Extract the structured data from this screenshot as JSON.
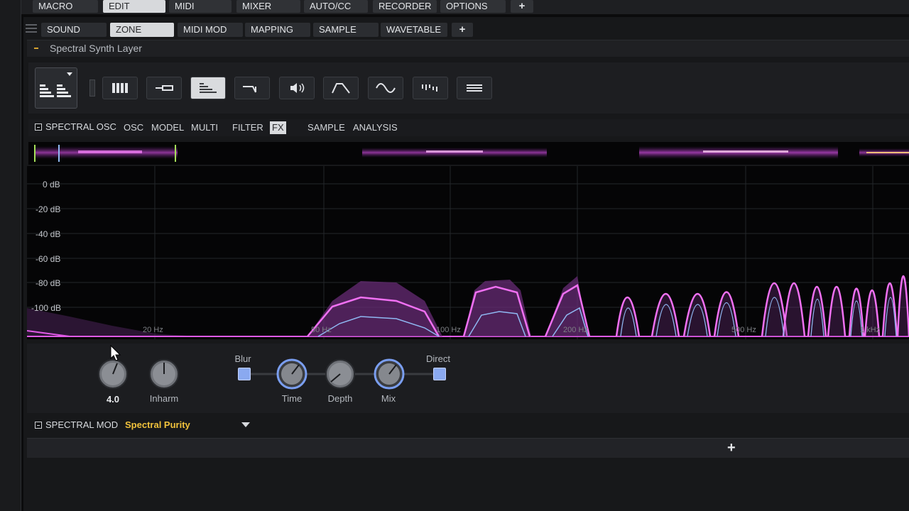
{
  "top_tabs": [
    {
      "label": "MACRO"
    },
    {
      "label": "EDIT",
      "active": true
    },
    {
      "label": "MIDI"
    },
    {
      "label": "MIXER"
    },
    {
      "label": "AUTO/CC"
    },
    {
      "label": "RECORDER"
    },
    {
      "label": "OPTIONS"
    },
    {
      "label": "+"
    }
  ],
  "sub_tabs": [
    {
      "label": "SOUND"
    },
    {
      "label": "ZONE",
      "active": true
    },
    {
      "label": "MIDI MOD"
    },
    {
      "label": "MAPPING"
    },
    {
      "label": "SAMPLE"
    },
    {
      "label": "WAVETABLE"
    },
    {
      "label": "+"
    }
  ],
  "layer": {
    "title": "Spectral Synth Layer"
  },
  "modules": [
    {
      "icon": "keyboard-icon"
    },
    {
      "icon": "pitch-icon"
    },
    {
      "icon": "spectral-osc-icon",
      "active": true
    },
    {
      "icon": "filter-envelope-icon"
    },
    {
      "icon": "amp-speaker-icon"
    },
    {
      "icon": "envelope-icon"
    },
    {
      "icon": "lfo-sine-icon"
    },
    {
      "icon": "step-sequencer-icon"
    },
    {
      "icon": "list-icon"
    }
  ],
  "spectral_osc": {
    "title": "SPECTRAL OSC",
    "tabs": [
      {
        "label": "OSC"
      },
      {
        "label": "MODEL"
      },
      {
        "label": "MULTI"
      },
      {
        "label": "FILTER"
      },
      {
        "label": "FX",
        "active": true
      },
      {
        "label": "SAMPLE"
      },
      {
        "label": "ANALYSIS"
      }
    ]
  },
  "graph": {
    "db_labels": [
      "0 dB",
      "-20 dB",
      "-40 dB",
      "-60 dB",
      "-80 dB",
      "-100 dB"
    ],
    "hz_labels": [
      "20 Hz",
      "50 Hz",
      "100 Hz",
      "200 Hz",
      "500 Hz",
      "1 kHz"
    ],
    "accent_color": "#e05ae6",
    "secondary_color": "#8fb8f2"
  },
  "controls": {
    "knob1_value": "4.0",
    "inharm_label": "Inharm",
    "blur_label": "Blur",
    "time_label": "Time",
    "depth_label": "Depth",
    "mix_label": "Mix",
    "direct_label": "Direct"
  },
  "spectral_mod": {
    "title": "SPECTRAL MOD",
    "selected": "Spectral Purity"
  }
}
